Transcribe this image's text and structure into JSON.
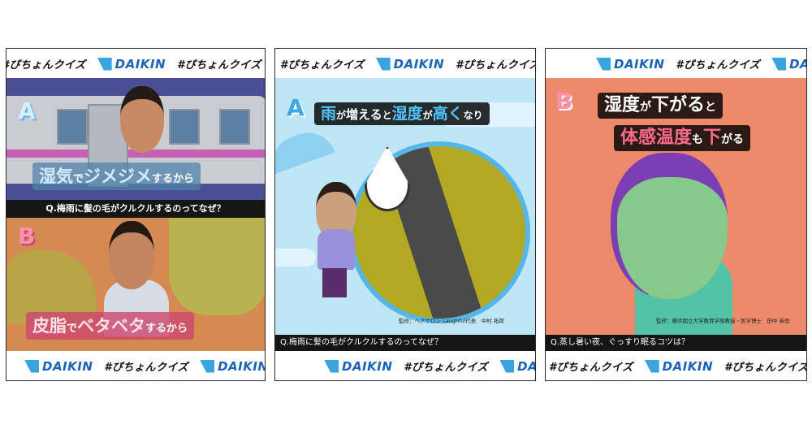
{
  "brand": {
    "logo_text": "DAIKIN",
    "hashtag": "#ぴちょんクイズ",
    "accent": "#1a63b8",
    "mark_color": "#3aa3e0"
  },
  "panel1": {
    "choice_a": "A",
    "choice_b": "B",
    "answer_a": {
      "hl1": "湿気",
      "t1": "で",
      "hl2": "ジメジメ",
      "t2": "するから"
    },
    "question": "Q.梅雨に髪の毛がクルクルするのってなぜ？",
    "answer_b": {
      "hl1": "皮脂",
      "t1": "で",
      "hl2": "ベタベタ",
      "t2": "するから"
    }
  },
  "panel2": {
    "choice": "A",
    "title": {
      "hl1": "雨",
      "t1": "が",
      "hl2": "増える",
      "t2": "と",
      "hl3": "湿度",
      "t3": "が",
      "hl4": "高く",
      "t4": "なり"
    },
    "credit": "監修：ヘアサロン Laughful代表　中村 拓郎",
    "question": "Q.梅雨に髪の毛がクルクルするのってなぜ？"
  },
  "panel3": {
    "choice": "B",
    "line1": {
      "hl1": "湿度",
      "t1": "が",
      "hl2": "下がる",
      "t2": "と"
    },
    "line2": {
      "hl1": "体感温度",
      "t1": "も",
      "hl2": "下",
      "t2": "がる"
    },
    "credit": "監修：横浜国立大学教育学部教授・医学博士　田中 英登",
    "question": "Q.蒸し暑い夜、ぐっすり眠るコツは？"
  }
}
